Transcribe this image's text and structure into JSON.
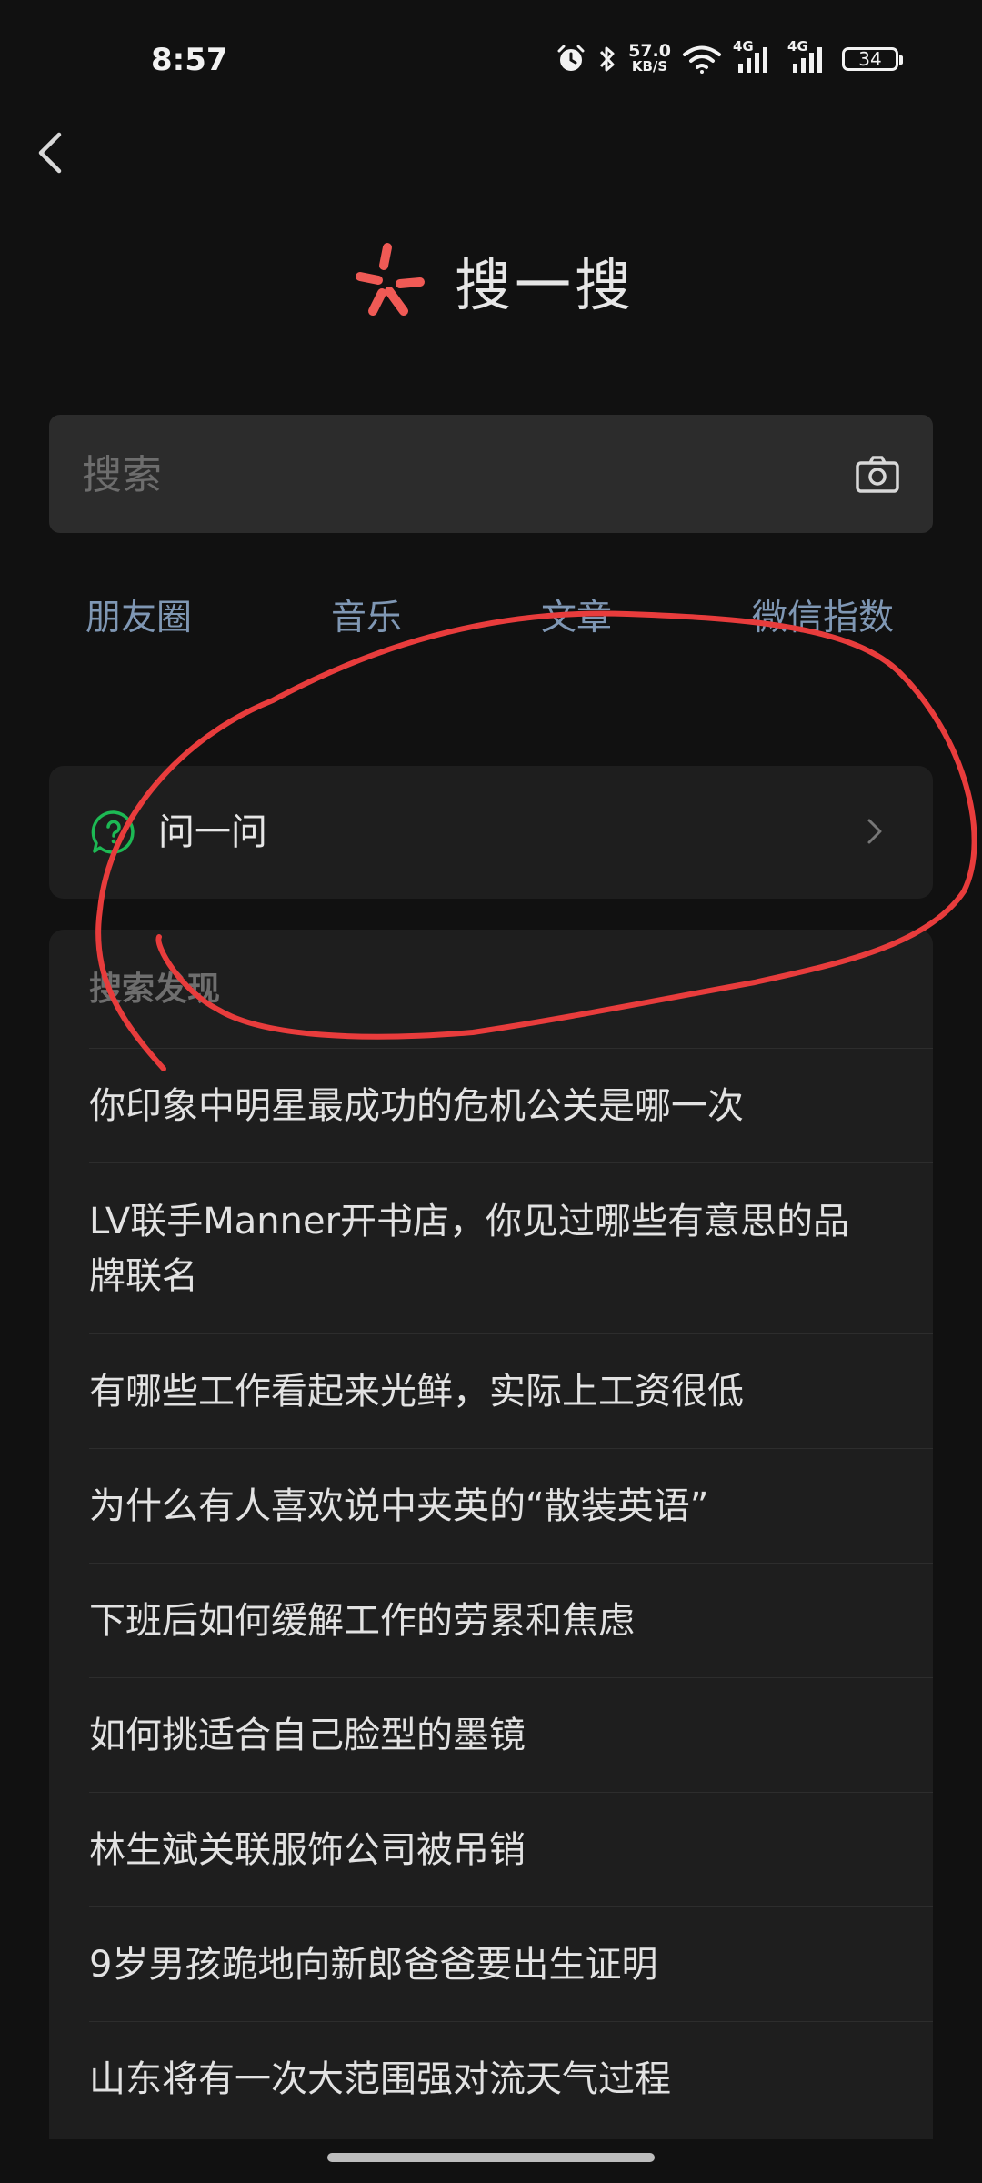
{
  "status_bar": {
    "time": "8:57",
    "network_speed_value": "57.0",
    "network_speed_unit": "KB/S",
    "signal_label_1": "4G",
    "signal_label_2": "4G",
    "battery": "34",
    "icons": [
      "alarm-icon",
      "bluetooth-icon",
      "wifi-icon",
      "signal-icon",
      "battery-icon"
    ]
  },
  "header": {
    "back_icon": "chevron-left-icon",
    "logo_icon": "sou-logo-icon",
    "title": "搜一搜"
  },
  "search": {
    "placeholder": "搜索",
    "value": "",
    "camera_icon": "camera-icon"
  },
  "categories": [
    {
      "label": "朋友圈"
    },
    {
      "label": "音乐"
    },
    {
      "label": "文章"
    },
    {
      "label": "微信指数"
    }
  ],
  "ask": {
    "label": "问一问",
    "icon": "question-bubble-icon",
    "chevron_icon": "chevron-right-icon"
  },
  "discover": {
    "title": "搜索发现",
    "items": [
      {
        "text": "你印象中明星最成功的危机公关是哪一次"
      },
      {
        "text": "LV联手Manner开书店，你见过哪些有意思的品牌联名"
      },
      {
        "text": "有哪些工作看起来光鲜，实际上工资很低"
      },
      {
        "text": "为什么有人喜欢说中夹英的“散装英语”"
      },
      {
        "text": "下班后如何缓解工作的劳累和焦虑"
      },
      {
        "text": "如何挑适合自己脸型的墨镜"
      },
      {
        "text": "林生斌关联服饰公司被吊销"
      },
      {
        "text": "9岁男孩跪地向新郎爸爸要出生证明"
      },
      {
        "text": "山东将有一次大范围强对流天气过程"
      }
    ]
  },
  "colors": {
    "background": "#111111",
    "card": "#1e1e1e",
    "search_box": "#2c2c2c",
    "category_text": "#7f97b4",
    "logo_red": "#f05a55",
    "ask_green": "#1db954",
    "annotation_red": "#e83c3c"
  }
}
